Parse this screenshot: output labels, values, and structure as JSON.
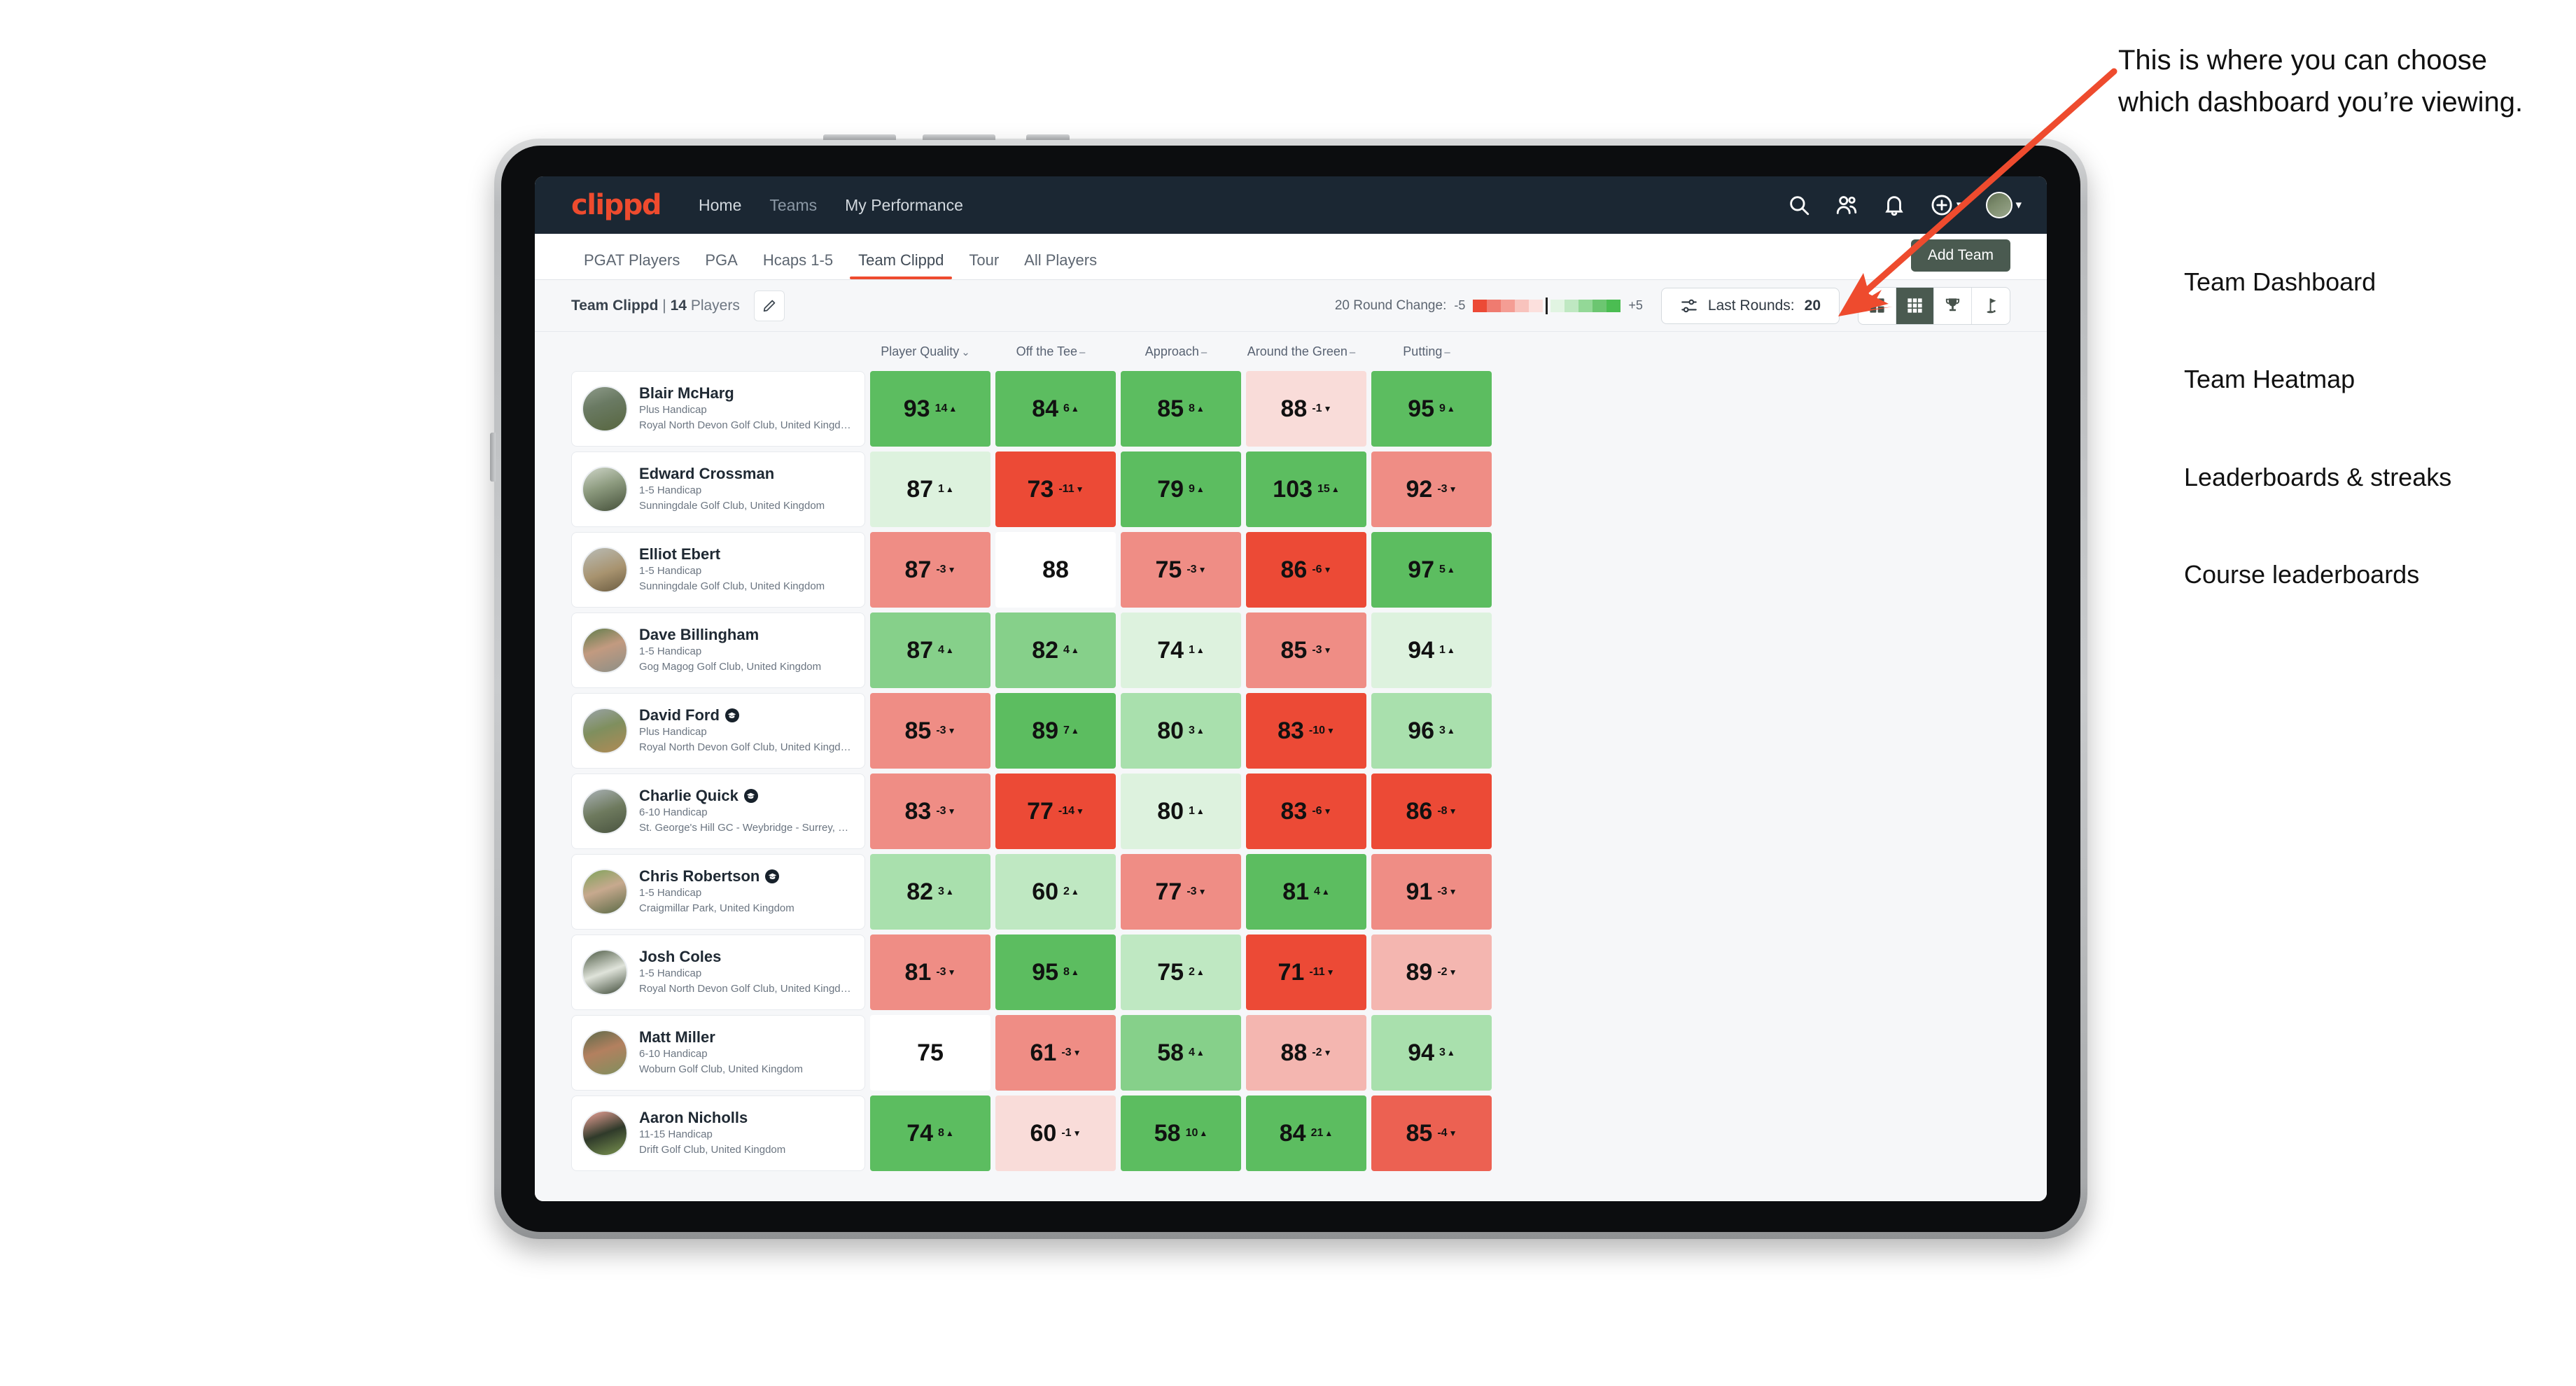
{
  "brand": "clippd",
  "nav": {
    "links": [
      "Home",
      "Teams",
      "My Performance"
    ],
    "icons": [
      "search-icon",
      "people-icon",
      "bell-icon",
      "plus-circle-icon",
      "avatar-icon"
    ]
  },
  "tabs": [
    {
      "label": "PGAT Players",
      "active": false
    },
    {
      "label": "PGA",
      "active": false
    },
    {
      "label": "Hcaps 1-5",
      "active": false
    },
    {
      "label": "Team Clippd",
      "active": true
    },
    {
      "label": "Tour",
      "active": false
    },
    {
      "label": "All Players",
      "active": false
    }
  ],
  "add_team_label": "Add Team",
  "toolbar": {
    "team_name": "Team Clippd",
    "team_separator": "|",
    "team_count": "14",
    "team_count_label": "Players",
    "round_change_label": "20 Round Change:",
    "scale_min": "-5",
    "scale_max": "+5",
    "last_rounds_label": "Last Rounds:",
    "last_rounds_value": "20",
    "view_toggle": [
      {
        "name": "dashboard-view",
        "active": false
      },
      {
        "name": "heatmap-view",
        "active": true
      },
      {
        "name": "leaderboard-view",
        "active": false
      },
      {
        "name": "course-view",
        "active": false
      }
    ]
  },
  "columns": [
    {
      "label": "Player Quality",
      "sym": "⌄"
    },
    {
      "label": "Off the Tee",
      "sym": "–"
    },
    {
      "label": "Approach",
      "sym": "–"
    },
    {
      "label": "Around the Green",
      "sym": "–"
    },
    {
      "label": "Putting",
      "sym": "–"
    }
  ],
  "colors": {
    "brand": "#ee4b2e",
    "navbar": "#1b2733",
    "accent_dark": "#4a5a50",
    "heat_strong_green": "#5cbd60",
    "heat_mid_green": "#86d08a",
    "heat_light_green": "#a9e0ad",
    "heat_pale_green": "#ddf2de",
    "heat_white": "#ffffff",
    "heat_pale_red": "#f9dcd9",
    "heat_light_red": "#f4b6b0",
    "heat_mid_red": "#ef8d85",
    "heat_strong_red": "#ec4a36"
  },
  "players": [
    {
      "name": "Blair McHarg",
      "grad": false,
      "handicap": "Plus Handicap",
      "club": "Royal North Devon Golf Club, United Kingdom",
      "avatar": "linear-gradient(160deg,#8e9b8a 0%,#6a7a63 40%,#57663f 100%)",
      "cells": [
        {
          "val": "93",
          "dlt": "14",
          "dir": "up",
          "bg": "#5cbd60"
        },
        {
          "val": "84",
          "dlt": "6",
          "dir": "up",
          "bg": "#5cbd60"
        },
        {
          "val": "85",
          "dlt": "8",
          "dir": "up",
          "bg": "#5cbd60"
        },
        {
          "val": "88",
          "dlt": "-1",
          "dir": "down",
          "bg": "#f9dcd9"
        },
        {
          "val": "95",
          "dlt": "9",
          "dir": "up",
          "bg": "#5cbd60"
        }
      ]
    },
    {
      "name": "Edward Crossman",
      "grad": false,
      "handicap": "1-5 Handicap",
      "club": "Sunningdale Golf Club, United Kingdom",
      "avatar": "linear-gradient(160deg,#cfd6c9 0%,#8c9a7e 45%,#45503a 100%)",
      "cells": [
        {
          "val": "87",
          "dlt": "1",
          "dir": "up",
          "bg": "#ddf2de"
        },
        {
          "val": "73",
          "dlt": "-11",
          "dir": "down",
          "bg": "#ec4a36"
        },
        {
          "val": "79",
          "dlt": "9",
          "dir": "up",
          "bg": "#5cbd60"
        },
        {
          "val": "103",
          "dlt": "15",
          "dir": "up",
          "bg": "#5cbd60"
        },
        {
          "val": "92",
          "dlt": "-3",
          "dir": "down",
          "bg": "#ef8d85"
        }
      ]
    },
    {
      "name": "Elliot Ebert",
      "grad": false,
      "handicap": "1-5 Handicap",
      "club": "Sunningdale Golf Club, United Kingdom",
      "avatar": "linear-gradient(160deg,#b9bcb6 0%,#a8936f 55%,#6b5c41 100%)",
      "cells": [
        {
          "val": "87",
          "dlt": "-3",
          "dir": "down",
          "bg": "#ef8d85"
        },
        {
          "val": "88",
          "dlt": "",
          "dir": "",
          "bg": "#ffffff"
        },
        {
          "val": "75",
          "dlt": "-3",
          "dir": "down",
          "bg": "#ef8d85"
        },
        {
          "val": "86",
          "dlt": "-6",
          "dir": "down",
          "bg": "#ec4a36"
        },
        {
          "val": "97",
          "dlt": "5",
          "dir": "up",
          "bg": "#5cbd60"
        }
      ]
    },
    {
      "name": "Dave Billingham",
      "grad": false,
      "handicap": "1-5 Handicap",
      "club": "Gog Magog Golf Club, United Kingdom",
      "avatar": "linear-gradient(160deg,#5f7c4a 0%,#c29a80 45%,#8c8f86 100%)",
      "cells": [
        {
          "val": "87",
          "dlt": "4",
          "dir": "up",
          "bg": "#86d08a"
        },
        {
          "val": "82",
          "dlt": "4",
          "dir": "up",
          "bg": "#86d08a"
        },
        {
          "val": "74",
          "dlt": "1",
          "dir": "up",
          "bg": "#ddf2de"
        },
        {
          "val": "85",
          "dlt": "-3",
          "dir": "down",
          "bg": "#ef8d85"
        },
        {
          "val": "94",
          "dlt": "1",
          "dir": "up",
          "bg": "#ddf2de"
        }
      ]
    },
    {
      "name": "David Ford",
      "grad": true,
      "handicap": "Plus Handicap",
      "club": "Royal North Devon Golf Club, United Kingdom",
      "avatar": "linear-gradient(160deg,#9aa3a8 0%,#7f8f5e 45%,#b08a55 100%)",
      "cells": [
        {
          "val": "85",
          "dlt": "-3",
          "dir": "down",
          "bg": "#ef8d85"
        },
        {
          "val": "89",
          "dlt": "7",
          "dir": "up",
          "bg": "#5cbd60"
        },
        {
          "val": "80",
          "dlt": "3",
          "dir": "up",
          "bg": "#a9e0ad"
        },
        {
          "val": "83",
          "dlt": "-10",
          "dir": "down",
          "bg": "#ec4a36"
        },
        {
          "val": "96",
          "dlt": "3",
          "dir": "up",
          "bg": "#a9e0ad"
        }
      ]
    },
    {
      "name": "Charlie Quick",
      "grad": true,
      "handicap": "6-10 Handicap",
      "club": "St. George's Hill GC - Weybridge - Surrey, Uni...",
      "avatar": "linear-gradient(160deg,#aab2b6 0%,#6e7a5e 50%,#4a5440 100%)",
      "cells": [
        {
          "val": "83",
          "dlt": "-3",
          "dir": "down",
          "bg": "#ef8d85"
        },
        {
          "val": "77",
          "dlt": "-14",
          "dir": "down",
          "bg": "#ec4a36"
        },
        {
          "val": "80",
          "dlt": "1",
          "dir": "up",
          "bg": "#ddf2de"
        },
        {
          "val": "83",
          "dlt": "-6",
          "dir": "down",
          "bg": "#ec4a36"
        },
        {
          "val": "86",
          "dlt": "-8",
          "dir": "down",
          "bg": "#ec4a36"
        }
      ]
    },
    {
      "name": "Chris Robertson",
      "grad": true,
      "handicap": "1-5 Handicap",
      "club": "Craigmillar Park, United Kingdom",
      "avatar": "linear-gradient(160deg,#7ea35a 0%,#c7a98e 45%,#5a6a45 100%)",
      "cells": [
        {
          "val": "82",
          "dlt": "3",
          "dir": "up",
          "bg": "#a9e0ad"
        },
        {
          "val": "60",
          "dlt": "2",
          "dir": "up",
          "bg": "#bfe8c2"
        },
        {
          "val": "77",
          "dlt": "-3",
          "dir": "down",
          "bg": "#ef8d85"
        },
        {
          "val": "81",
          "dlt": "4",
          "dir": "up",
          "bg": "#5cbd60"
        },
        {
          "val": "91",
          "dlt": "-3",
          "dir": "down",
          "bg": "#ef8d85"
        }
      ]
    },
    {
      "name": "Josh Coles",
      "grad": false,
      "handicap": "1-5 Handicap",
      "club": "Royal North Devon Golf Club, United Kingdom",
      "avatar": "linear-gradient(160deg,#4d5a44 0%,#dfe3da 50%,#3e4a38 100%)",
      "cells": [
        {
          "val": "81",
          "dlt": "-3",
          "dir": "down",
          "bg": "#ef8d85"
        },
        {
          "val": "95",
          "dlt": "8",
          "dir": "up",
          "bg": "#5cbd60"
        },
        {
          "val": "75",
          "dlt": "2",
          "dir": "up",
          "bg": "#bfe8c2"
        },
        {
          "val": "71",
          "dlt": "-11",
          "dir": "down",
          "bg": "#ec4a36"
        },
        {
          "val": "89",
          "dlt": "-2",
          "dir": "down",
          "bg": "#f4b6b0"
        }
      ]
    },
    {
      "name": "Matt Miller",
      "grad": false,
      "handicap": "6-10 Handicap",
      "club": "Woburn Golf Club, United Kingdom",
      "avatar": "linear-gradient(160deg,#5c6a4a 0%,#b3805f 45%,#7f8f5e 100%)",
      "cells": [
        {
          "val": "75",
          "dlt": "",
          "dir": "",
          "bg": "#ffffff"
        },
        {
          "val": "61",
          "dlt": "-3",
          "dir": "down",
          "bg": "#ef8d85"
        },
        {
          "val": "58",
          "dlt": "4",
          "dir": "up",
          "bg": "#86d08a"
        },
        {
          "val": "88",
          "dlt": "-2",
          "dir": "down",
          "bg": "#f4b6b0"
        },
        {
          "val": "94",
          "dlt": "3",
          "dir": "up",
          "bg": "#a9e0ad"
        }
      ]
    },
    {
      "name": "Aaron Nicholls",
      "grad": false,
      "handicap": "11-15 Handicap",
      "club": "Drift Golf Club, United Kingdom",
      "avatar": "linear-gradient(160deg,#f0a49a 0%,#2f3a2a 50%,#7b9450 100%)",
      "cells": [
        {
          "val": "74",
          "dlt": "8",
          "dir": "up",
          "bg": "#5cbd60"
        },
        {
          "val": "60",
          "dlt": "-1",
          "dir": "down",
          "bg": "#f9dcd9"
        },
        {
          "val": "58",
          "dlt": "10",
          "dir": "up",
          "bg": "#5cbd60"
        },
        {
          "val": "84",
          "dlt": "21",
          "dir": "up",
          "bg": "#5cbd60"
        },
        {
          "val": "85",
          "dlt": "-4",
          "dir": "down",
          "bg": "#ec6152"
        }
      ]
    }
  ],
  "annotation": {
    "callout": "This is where you can choose which dashboard you’re viewing.",
    "items": [
      "Team Dashboard",
      "Team Heatmap",
      "Leaderboards & streaks",
      "Course leaderboards"
    ],
    "arrow_color": "#ee4b2e"
  }
}
